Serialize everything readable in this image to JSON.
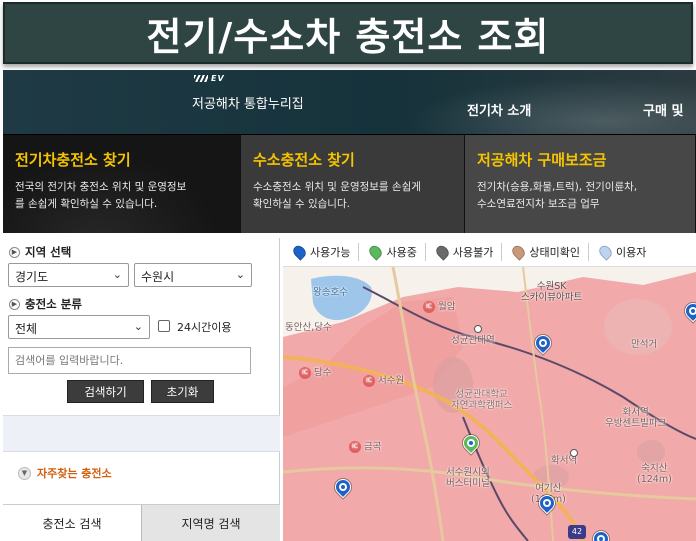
{
  "banner": {
    "title": "전기/수소차 충전소 조회"
  },
  "header": {
    "badge": "EV",
    "site_name": "저공해차 통합누리집",
    "nav": [
      "전기차 소개",
      "구매 및"
    ]
  },
  "cards": [
    {
      "title": "전기차충전소 찾기",
      "desc_line1": "전국의 전기차 충전소 위치 및 운영정보",
      "desc_line2": "를 손쉽게 확인하실 수 있습니다."
    },
    {
      "title": "수소충전소 찾기",
      "desc_line1": "수소충전소 위치 및 운영정보를 손쉽게",
      "desc_line2": "확인하실 수 있습니다."
    },
    {
      "title": "저공해차 구매보조금",
      "desc_line1": "전기차(승용,화물,트럭), 전기이륜차,",
      "desc_line2": "수소연료전지차 보조금 업무"
    }
  ],
  "filters": {
    "region_label": "지역 선택",
    "region_province": "경기도",
    "region_city": "수원시",
    "type_label": "충전소 분류",
    "type_value": "전체",
    "open24_label": "24시간이용",
    "open24_checked": false,
    "search_placeholder": "검색어를 입력바랍니다.",
    "search_button": "검색하기",
    "reset_button": "초기화"
  },
  "favorites": {
    "label": "자주찾는 충전소"
  },
  "tabs": [
    "충전소 검색",
    "지역명 검색"
  ],
  "legend": [
    {
      "label": "사용가능",
      "color": "#1e62c8"
    },
    {
      "label": "사용중",
      "color": "#5cb85c"
    },
    {
      "label": "사용불가",
      "color": "#6a6a6a"
    },
    {
      "label": "상태미확인",
      "color": "#c89a78"
    },
    {
      "label": "이용자",
      "color": "#bcd4f2"
    }
  ],
  "map": {
    "labels": {
      "lake": "왕송호수",
      "ic_wolam": "월암",
      "apt": "수원SK\n스카이뷰아파트",
      "station_sungkyun": "성균관대역",
      "dangsu_top": "동안산,당수",
      "ic_dangsu": "당수",
      "ic_suwon": "서수원",
      "univ": "성균관대학교\n자연과학캠퍼스",
      "mangan": "만석거",
      "hwaseo_park": "화서역\n우방센트빌파크",
      "ic_geumgok": "금곡",
      "station_hwaseo": "화서역",
      "bus_terminal": "서수원시외\n버스터미널",
      "mountain_yeogi": "여기산\n(105m)",
      "mountain_suk": "숙지산\n(124m)",
      "route_42": "42"
    }
  }
}
